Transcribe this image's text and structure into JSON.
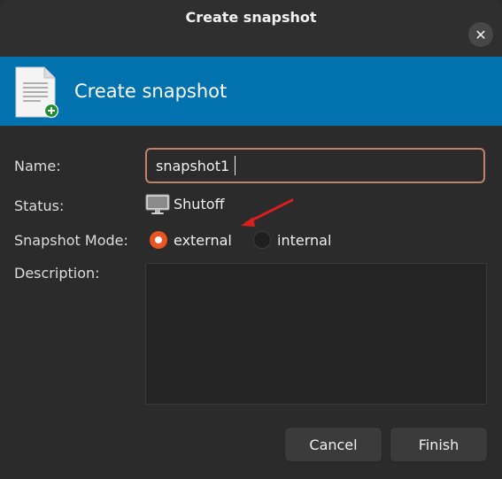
{
  "window": {
    "title": "Create snapshot"
  },
  "banner": {
    "title": "Create snapshot",
    "icon": "document-add-icon"
  },
  "form": {
    "name_label": "Name:",
    "name_value": "snapshot1",
    "status_label": "Status:",
    "status_value": "Shutoff",
    "status_icon": "monitor-icon",
    "mode_label": "Snapshot Mode:",
    "mode_options": [
      {
        "label": "external",
        "selected": true
      },
      {
        "label": "internal",
        "selected": false
      }
    ],
    "description_label": "Description:",
    "description_value": ""
  },
  "buttons": {
    "cancel": "Cancel",
    "finish": "Finish"
  },
  "colors": {
    "banner": "#0272ae",
    "accent": "#e95420",
    "focus_border": "#c1806a",
    "annotation_arrow": "#d62020"
  }
}
